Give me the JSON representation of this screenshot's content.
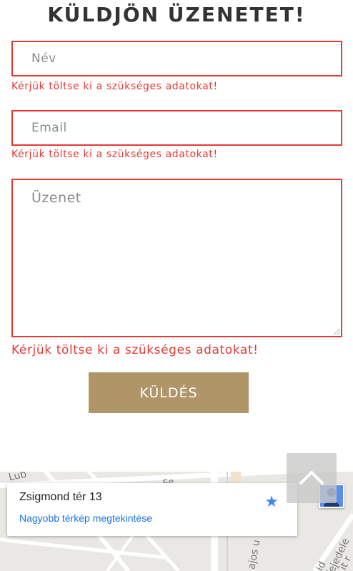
{
  "form": {
    "title": "KÜLDJÖN ÜZENETET!",
    "name_placeholder": "Név",
    "email_placeholder": "Email",
    "message_placeholder": "Üzenet",
    "error_text": "Kérjük töltse ki a szükséges adatokat!",
    "submit_label": "KÜLDÉS"
  },
  "map": {
    "address": "Zsigmond tér 13",
    "view_larger_link": "Nagyobb térkép megtekintése",
    "street_labels": [
      "Lub",
      "Fe",
      "ajos u",
      "id fejedele",
      "it r"
    ]
  },
  "colors": {
    "accent": "#b09569",
    "error": "#e53935",
    "link": "#1a73e8",
    "star": "#4285f4"
  },
  "icons": {
    "star": "star-icon",
    "avatar": "pegman-icon",
    "back_to_top": "chevron-up-icon"
  }
}
